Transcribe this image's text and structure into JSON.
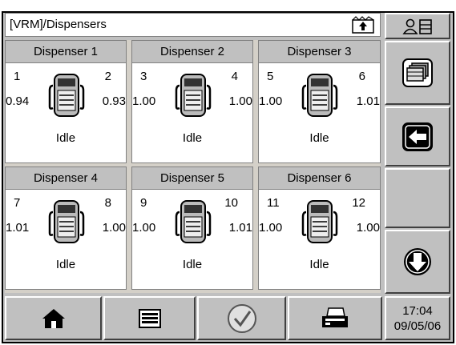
{
  "titlebar": {
    "title": "[VRM]/Dispensers",
    "up_icon": "folder-up-icon"
  },
  "dispensers": [
    {
      "name": "Dispenser 1",
      "left_pump": "1",
      "right_pump": "2",
      "left_value": "0.94",
      "right_value": "0.93",
      "status": "Idle"
    },
    {
      "name": "Dispenser 2",
      "left_pump": "3",
      "right_pump": "4",
      "left_value": "1.00",
      "right_value": "1.00",
      "status": "Idle"
    },
    {
      "name": "Dispenser 3",
      "left_pump": "5",
      "right_pump": "6",
      "left_value": "1.00",
      "right_value": "1.01",
      "status": "Idle"
    },
    {
      "name": "Dispenser 4",
      "left_pump": "7",
      "right_pump": "8",
      "left_value": "1.01",
      "right_value": "1.00",
      "status": "Idle"
    },
    {
      "name": "Dispenser 5",
      "left_pump": "9",
      "right_pump": "10",
      "left_value": "1.00",
      "right_value": "1.01",
      "status": "Idle"
    },
    {
      "name": "Dispenser 6",
      "left_pump": "11",
      "right_pump": "12",
      "left_value": "1.00",
      "right_value": "1.00",
      "status": "Idle"
    }
  ],
  "side_buttons": [
    "user-list-icon",
    "list-view-icon",
    "back-arrow-icon",
    "blank",
    "scroll-down-icon"
  ],
  "bottom_buttons": [
    "home-icon",
    "list-icon",
    "checkmark-icon",
    "printer-icon"
  ],
  "clock": {
    "time": "17:04",
    "date": "09/05/06"
  },
  "colors": {
    "frame": "#c0c0c0",
    "panel": "#ffffff",
    "border": "#808080"
  }
}
